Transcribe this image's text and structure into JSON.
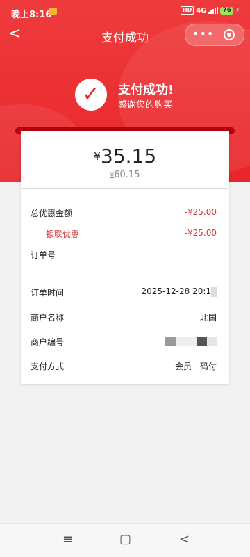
{
  "status_bar": {
    "time": "晚上8:16",
    "network": "4G",
    "battery": "76"
  },
  "nav": {
    "back_label": "<",
    "title": "支付成功",
    "more_label": "•••"
  },
  "success": {
    "title": "支付成功!",
    "subtitle": "感谢您的购买"
  },
  "payment": {
    "currency_symbol": "¥",
    "amount": "35.15",
    "original_amount": "60.15"
  },
  "details": [
    {
      "label": "总优惠金额",
      "value": "-¥25.00"
    },
    {
      "label": "银联优惠",
      "value": "-¥25.00"
    },
    {
      "label": "订单号",
      "value": ""
    },
    {
      "label": "订单时间",
      "value": "2025-12-28 20:1"
    },
    {
      "label": "商户名称",
      "value": "北国"
    },
    {
      "label": "商户编号",
      "value": ""
    },
    {
      "label": "支付方式",
      "value": "会员一码付"
    }
  ],
  "bottom_nav": {
    "menu": "≡",
    "home": "▢",
    "back": "<"
  },
  "colors": {
    "brand_red": "#e8262b",
    "discount_red": "#d03a3a"
  }
}
